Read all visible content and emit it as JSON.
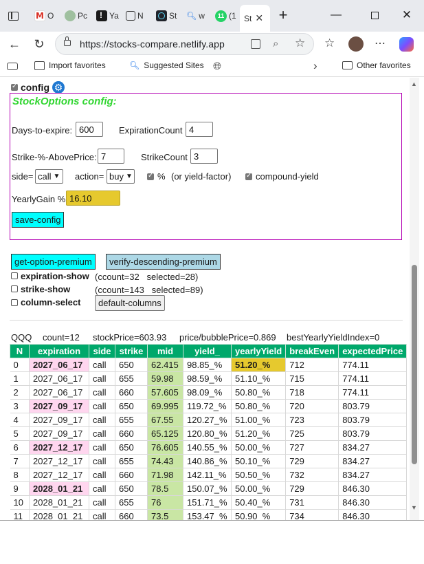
{
  "browser": {
    "tabs": [
      {
        "short": "O"
      },
      {
        "short": "Pc"
      },
      {
        "short": "Ya"
      },
      {
        "short": "N"
      },
      {
        "short": "St"
      },
      {
        "short": "w"
      },
      {
        "badge": "11",
        "short": "(1"
      },
      {
        "short": "St",
        "active": true
      }
    ],
    "new_tab": "+",
    "url": "https://stocks-compare.netlify.app",
    "favorites": {
      "import": "Import favorites",
      "suggested": "Suggested Sites",
      "other": "Other favorites"
    }
  },
  "page": {
    "config_toggle_label": "config",
    "config_toggle_checked": true,
    "config_title": "StockOptions config:",
    "days_to_expire_label": "Days-to-expire:",
    "days_to_expire_value": "600",
    "expiration_count_label": "ExpirationCount",
    "expiration_count_value": "4",
    "strike_pct_label": "Strike-%-AbovePrice:",
    "strike_pct_value": "7",
    "strike_count_label": "StrikeCount",
    "strike_count_value": "3",
    "side_label": "side=",
    "side_value": "call",
    "action_label": "action=",
    "action_value": "buy",
    "percent_label": "%",
    "percent_note": "(or yield-factor)",
    "compound_label": "compound-yield",
    "yearly_gain_label": "YearlyGain %",
    "yearly_gain_value": "16.10",
    "save_button": "save-config",
    "get_premium_button": "get-option-premium",
    "verify_button": "verify-descending-premium",
    "expiration_show_label": "expiration-show",
    "expiration_show_info": "(ccount=32   selected=28)",
    "strike_show_label": "strike-show",
    "strike_show_info": "(ccount=143   selected=89)",
    "column_select_label": "column-select",
    "default_columns_button": "default-columns",
    "summary": {
      "symbol": "QQQ",
      "count": "count=12",
      "stock_price": "stockPrice=603.93",
      "bubble": "price/bubblePrice=0.869",
      "best_index": "bestYearlyYieldIndex=0"
    },
    "table": {
      "headers": [
        "N",
        "expiration",
        "side",
        "strike",
        "mid",
        "yield_",
        "yearlyYield",
        "breakEven",
        "expectedPrice"
      ],
      "rows": [
        [
          "0",
          "2027_06_17",
          "call",
          "650",
          "62.415",
          "98.85_%",
          "51.20_%",
          "712",
          "774.11"
        ],
        [
          "1",
          "2027_06_17",
          "call",
          "655",
          "59.98",
          "98.59_%",
          "51.10_%",
          "715",
          "774.11"
        ],
        [
          "2",
          "2027_06_17",
          "call",
          "660",
          "57.605",
          "98.09_%",
          "50.80_%",
          "718",
          "774.11"
        ],
        [
          "3",
          "2027_09_17",
          "call",
          "650",
          "69.995",
          "119.72_%",
          "50.80_%",
          "720",
          "803.79"
        ],
        [
          "4",
          "2027_09_17",
          "call",
          "655",
          "67.55",
          "120.27_%",
          "51.00_%",
          "723",
          "803.79"
        ],
        [
          "5",
          "2027_09_17",
          "call",
          "660",
          "65.125",
          "120.80_%",
          "51.20_%",
          "725",
          "803.79"
        ],
        [
          "6",
          "2027_12_17",
          "call",
          "650",
          "76.605",
          "140.55_%",
          "50.00_%",
          "727",
          "834.27"
        ],
        [
          "7",
          "2027_12_17",
          "call",
          "655",
          "74.43",
          "140.86_%",
          "50.10_%",
          "729",
          "834.27"
        ],
        [
          "8",
          "2027_12_17",
          "call",
          "660",
          "71.98",
          "142.11_%",
          "50.50_%",
          "732",
          "834.27"
        ],
        [
          "9",
          "2028_01_21",
          "call",
          "650",
          "78.5",
          "150.07_%",
          "50.00_%",
          "729",
          "846.30"
        ],
        [
          "10",
          "2028_01_21",
          "call",
          "655",
          "76",
          "151.71_%",
          "50.40_%",
          "731",
          "846.30"
        ],
        [
          "11",
          "2028_01_21",
          "call",
          "660",
          "73.5",
          "153.47_%",
          "50.90_%",
          "734",
          "846.30"
        ]
      ],
      "highlight_expiration_rows": [
        0,
        3,
        6,
        9
      ],
      "best_yield_row": 0
    }
  },
  "colors": {
    "header_green": "#00a86b",
    "expiration_pink": "#ffd6ef",
    "mid_green": "#c9e6a4",
    "best_yellow": "#e6c92e",
    "cyan_button": "#00ffff",
    "config_border": "#b300b3",
    "config_title": "#33d633",
    "yearly_gain_bg": "#e6c92e"
  },
  "icons": [
    "sidebar-toggle-icon",
    "gmail-icon",
    "profile-icon",
    "yahoo-icon",
    "news-icon",
    "react-icon",
    "search-icon",
    "whatsapp-icon",
    "new-tab-icon",
    "minimize-icon",
    "maximize-icon",
    "close-icon",
    "back-icon",
    "refresh-icon",
    "lock-icon",
    "app-icon",
    "zoom-icon",
    "star-icon",
    "favorites-icon",
    "avatar",
    "more-icon",
    "copilot-icon",
    "gear-icon"
  ]
}
